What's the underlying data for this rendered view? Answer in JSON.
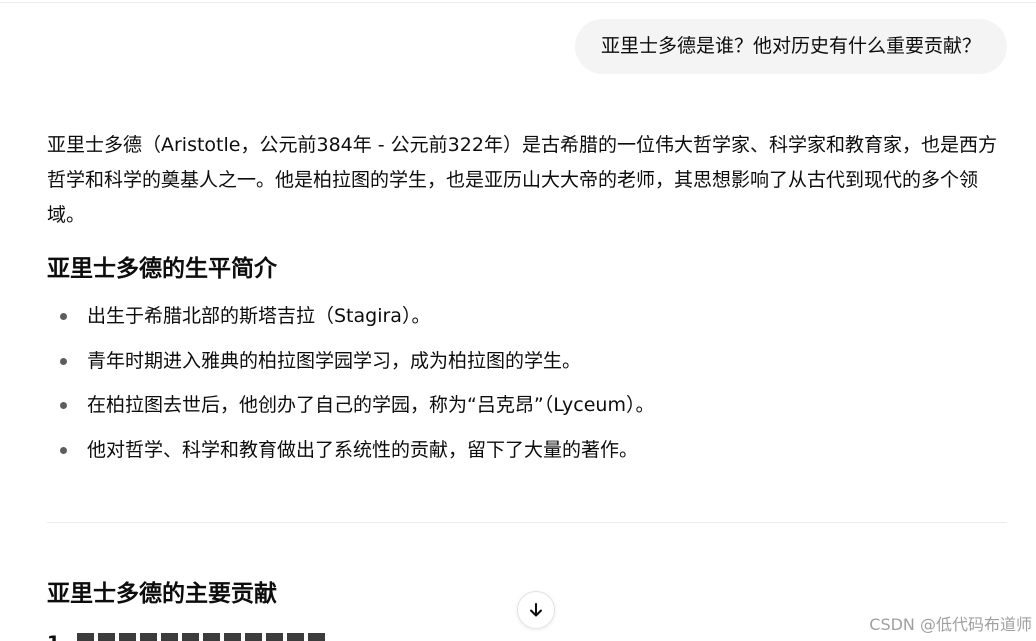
{
  "conversation": {
    "user_message": "亚里士多德是谁？他对历史有什么重要贡献？",
    "answer": {
      "intro": "亚里士多德（Aristotle，公元前384年 - 公元前322年）是古希腊的一位伟大哲学家、科学家和教育家，也是西方哲学和科学的奠基人之一。他是柏拉图的学生，也是亚历山大大帝的老师，其思想影响了从古代到现代的多个领域。",
      "section_life": {
        "title": "亚里士多德的生平简介",
        "items": [
          "出生于希腊北部的斯塔吉拉（Stagira）。",
          "青年时期进入雅典的柏拉图学园学习，成为柏拉图的学生。",
          "在柏拉图去世后，他创办了自己的学园，称为“吕克昂”（Lyceum）。",
          "他对哲学、科学和教育做出了系统性的贡献，留下了大量的著作。"
        ]
      },
      "section_contrib": {
        "title": "亚里士多德的主要贡献",
        "cut_number": "1."
      }
    }
  },
  "controls": {
    "scroll_down_icon": "arrow-down-icon"
  },
  "watermark": "CSDN @低代码布道师",
  "colors": {
    "bubble_bg": "#f4f4f4",
    "text": "#0d0d0d",
    "divider": "#ececec",
    "watermark": "#a0a0a0"
  }
}
